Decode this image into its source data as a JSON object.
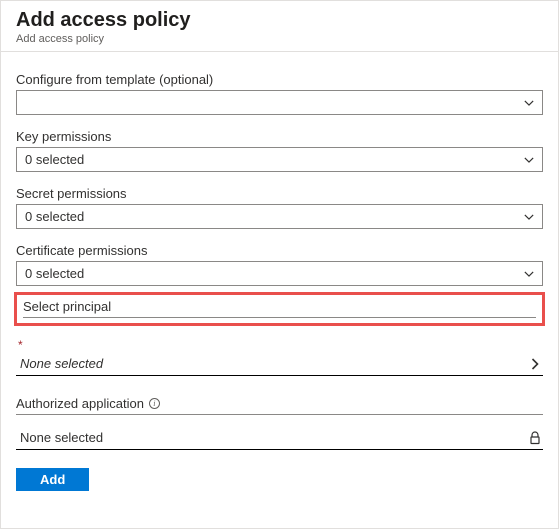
{
  "header": {
    "title": "Add access policy",
    "subtitle": "Add access policy"
  },
  "fields": {
    "template": {
      "label": "Configure from template (optional)",
      "value": ""
    },
    "key": {
      "label": "Key permissions",
      "value": "0 selected"
    },
    "secret": {
      "label": "Secret permissions",
      "value": "0 selected"
    },
    "cert": {
      "label": "Certificate permissions",
      "value": "0 selected"
    }
  },
  "principal": {
    "section": "Select principal",
    "value": "None selected"
  },
  "authapp": {
    "section": "Authorized application",
    "value": "None selected"
  },
  "buttons": {
    "add": "Add"
  },
  "colors": {
    "primary": "#0078d4",
    "highlight": "#e94f4c"
  }
}
